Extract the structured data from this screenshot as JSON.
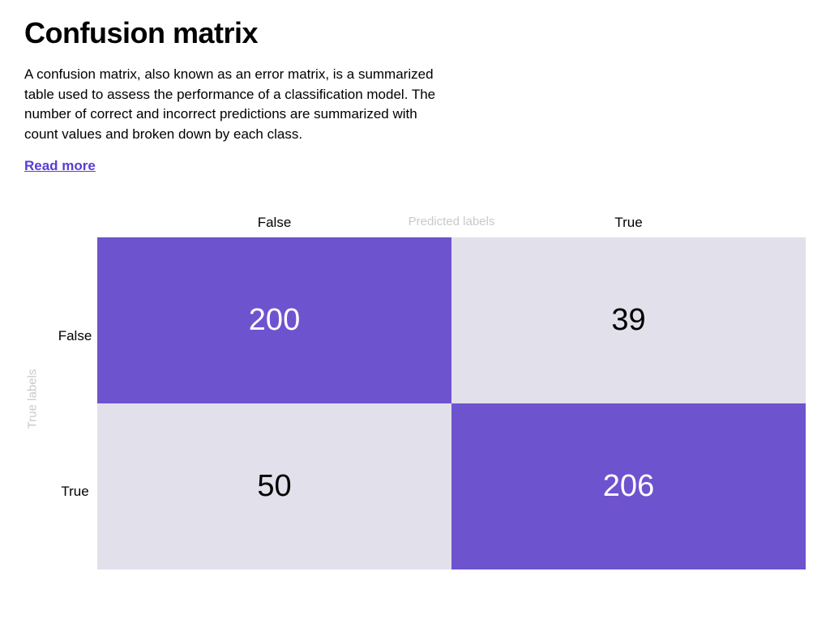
{
  "header": {
    "title": "Confusion matrix",
    "description": "A confusion matrix, also known as an error matrix, is a summarized table used to assess the performance of a classification model. The number of correct and incorrect predictions are summarized with count values and broken down by each class.",
    "read_more": "Read more"
  },
  "axes": {
    "x_title": "Predicted labels",
    "y_title": "True labels",
    "cols": [
      "False",
      "True"
    ],
    "rows": [
      "False",
      "True"
    ]
  },
  "cells": {
    "tn": "200",
    "fp": "39",
    "fn": "50",
    "tp": "206"
  },
  "chart_data": {
    "type": "heatmap",
    "title": "Confusion matrix",
    "xlabel": "Predicted labels",
    "ylabel": "True labels",
    "x_categories": [
      "False",
      "True"
    ],
    "y_categories": [
      "False",
      "True"
    ],
    "values": [
      [
        200,
        39
      ],
      [
        50,
        206
      ]
    ],
    "color_scale": {
      "low": "#e2e0ea",
      "high": "#6e53cf"
    }
  }
}
